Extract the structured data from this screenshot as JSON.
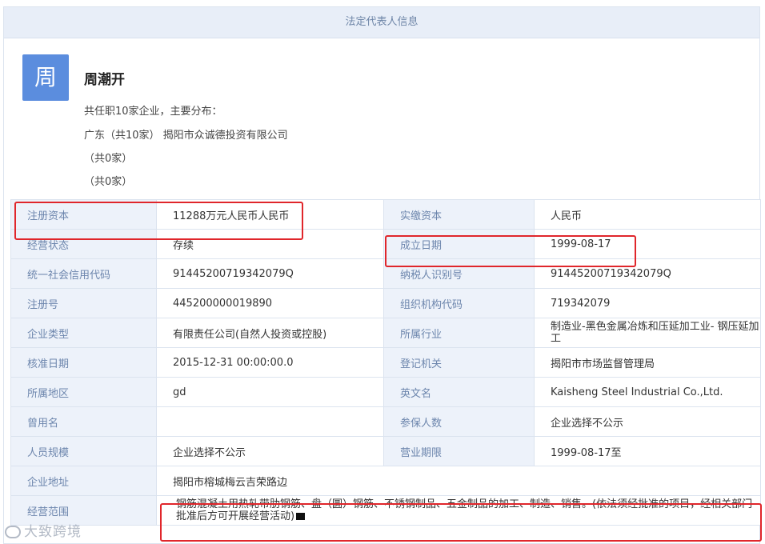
{
  "panel": {
    "title": "法定代表人信息"
  },
  "person": {
    "avatar_char": "周",
    "name": "周潮开",
    "summary": "共任职10家企业，主要分布：",
    "regions": [
      "广东（共10家） 揭阳市众诚德投资有限公司",
      "（共0家）",
      "（共0家）"
    ]
  },
  "table": {
    "rows": [
      [
        {
          "k": "注册资本",
          "v": "11288万元人民币人民币"
        },
        {
          "k": "实缴资本",
          "v": "人民币"
        }
      ],
      [
        {
          "k": "经营状态",
          "v": "存续"
        },
        {
          "k": "成立日期",
          "v": "1999-08-17"
        }
      ],
      [
        {
          "k": "统一社会信用代码",
          "v": "91445200719342079Q"
        },
        {
          "k": "纳税人识别号",
          "v": "91445200719342079Q"
        }
      ],
      [
        {
          "k": "注册号",
          "v": "445200000019890"
        },
        {
          "k": "组织机构代码",
          "v": "719342079"
        }
      ],
      [
        {
          "k": "企业类型",
          "v": "有限责任公司(自然人投资或控股)"
        },
        {
          "k": "所属行业",
          "v": "制造业-黑色金属冶炼和压延加工业- 钢压延加工"
        }
      ],
      [
        {
          "k": "核准日期",
          "v": "2015-12-31 00:00:00.0"
        },
        {
          "k": "登记机关",
          "v": "揭阳市市场监督管理局"
        }
      ],
      [
        {
          "k": "所属地区",
          "v": "gd"
        },
        {
          "k": "英文名",
          "v": "Kaisheng Steel Industrial Co.,Ltd."
        }
      ],
      [
        {
          "k": "曾用名",
          "v": ""
        },
        {
          "k": "参保人数",
          "v": "企业选择不公示"
        }
      ],
      [
        {
          "k": "人员规模",
          "v": "企业选择不公示"
        },
        {
          "k": "营业期限",
          "v": "1999-08-17至"
        }
      ]
    ],
    "address": {
      "k": "企业地址",
      "v": "揭阳市榕城梅云吉荣路边"
    },
    "scope": {
      "k": "经营范围",
      "v": "钢筋混凝土用热轧带肋钢筋、盘（圆）钢筋、不锈钢制品、五金制品的加工、制造、销售。(依法须经批准的项目，经相关部门批准后方可开展经营活动)"
    }
  },
  "watermark": {
    "text": "大致跨境"
  },
  "colors": {
    "highlight": "#e0262b",
    "avatar": "#5b8dde",
    "key_bg": "#edf2fa"
  }
}
